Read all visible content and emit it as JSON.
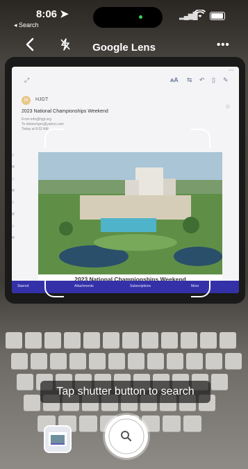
{
  "status": {
    "time": "8:06",
    "back_label": "◂ Search"
  },
  "header": {
    "title": "Google Lens",
    "back_icon": "chevron-left-icon",
    "flash_icon": "flash-off-icon",
    "more_icon": "more-dots-icon"
  },
  "tablet": {
    "sender_initial": "H",
    "sender": "HJGT",
    "subject": "2023 National Championships Weekend",
    "from_line": "From info@hjgt.org",
    "to_line": "To tdvtmchgrc@yahoo.com",
    "date_line": "Today at 8:02 AM",
    "photo_caption": "2023 National Championships Weekend",
    "bottom_tabs": [
      "Starred",
      "Attachments",
      "Subscriptions",
      "More"
    ]
  },
  "hint": "Tap shutter button to search",
  "controls": {
    "gallery_icon": "gallery-thumbnail",
    "shutter_icon": "search-icon"
  }
}
